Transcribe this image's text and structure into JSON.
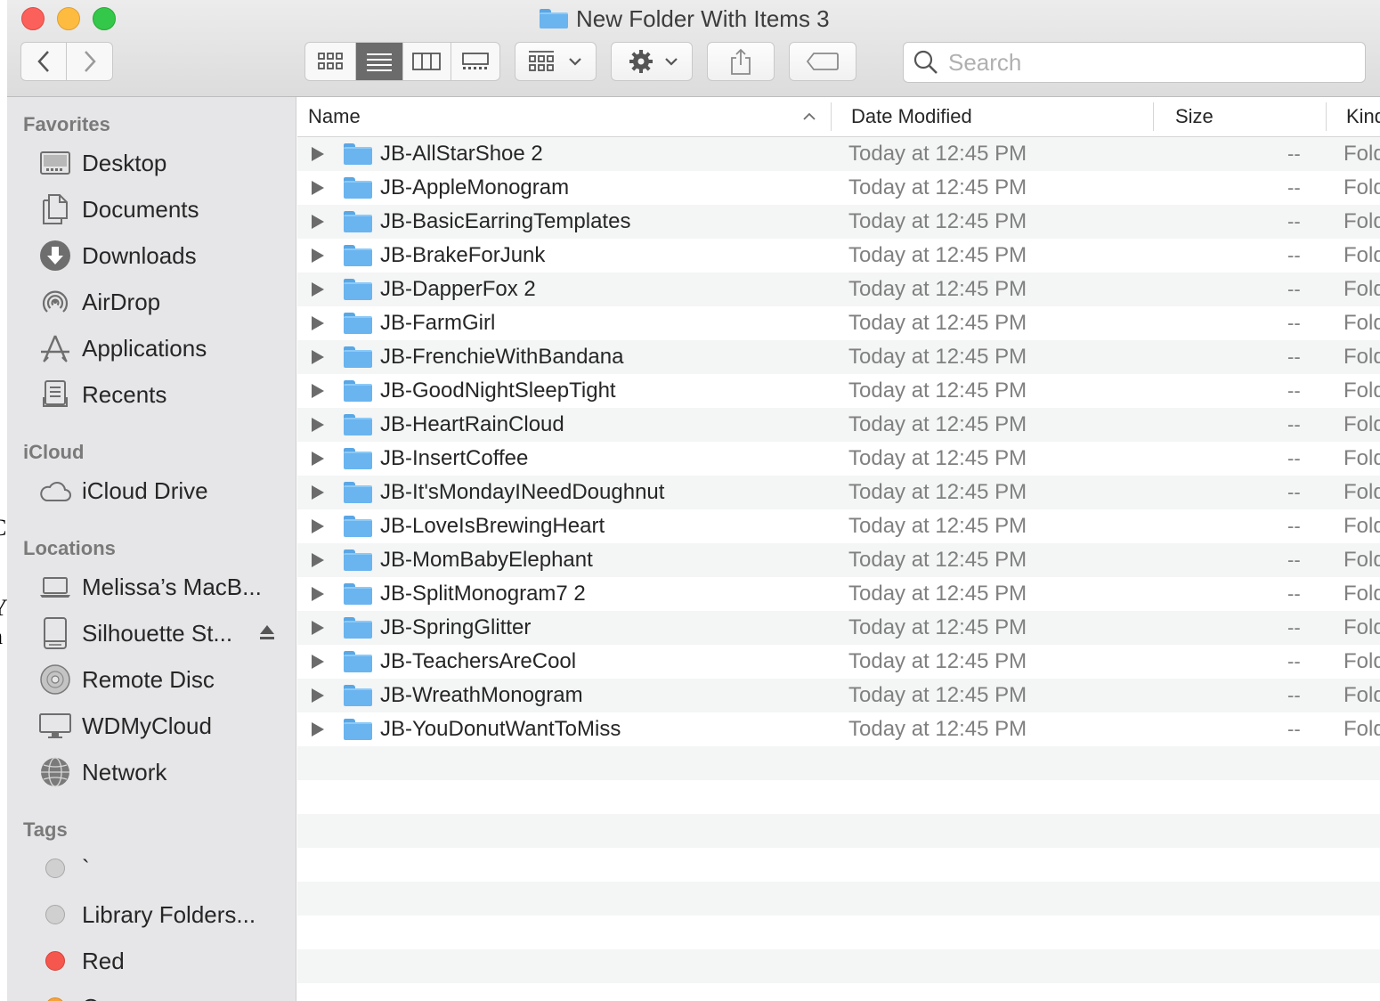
{
  "window": {
    "title": "New Folder With Items 3"
  },
  "background_fragments": [
    "C",
    "Y",
    "h"
  ],
  "toolbar": {
    "back_icon": "chevron-left-icon",
    "forward_icon": "chevron-right-icon",
    "view_modes": [
      "icon-view-icon",
      "list-view-icon",
      "column-view-icon",
      "gallery-view-icon"
    ],
    "active_view": "list",
    "search_placeholder": "Search"
  },
  "sidebar": {
    "sections": [
      {
        "heading": "Favorites",
        "items": [
          {
            "label": "Desktop",
            "icon": "desktop-icon"
          },
          {
            "label": "Documents",
            "icon": "documents-icon"
          },
          {
            "label": "Downloads",
            "icon": "downloads-icon"
          },
          {
            "label": "AirDrop",
            "icon": "airdrop-icon"
          },
          {
            "label": "Applications",
            "icon": "applications-icon"
          },
          {
            "label": "Recents",
            "icon": "recents-icon"
          }
        ]
      },
      {
        "heading": "iCloud",
        "items": [
          {
            "label": "iCloud Drive",
            "icon": "cloud-icon"
          }
        ]
      },
      {
        "heading": "Locations",
        "items": [
          {
            "label": "Melissa’s MacB...",
            "icon": "laptop-icon"
          },
          {
            "label": "Silhouette St...",
            "icon": "drive-icon",
            "eject": true
          },
          {
            "label": "Remote Disc",
            "icon": "disc-icon"
          },
          {
            "label": "WDMyCloud",
            "icon": "monitor-icon"
          },
          {
            "label": "Network",
            "icon": "globe-icon"
          }
        ]
      },
      {
        "heading": "Tags",
        "items": [
          {
            "label": "`",
            "icon": "tag-gray-icon",
            "color": "#d0d0d0"
          },
          {
            "label": "Library Folders...",
            "icon": "tag-gray-icon",
            "color": "#d0d0d0"
          },
          {
            "label": "Red",
            "icon": "tag-red-icon",
            "color": "#f5564e"
          },
          {
            "label": "O",
            "icon": "tag-orange-icon",
            "color": "#f7a33a"
          }
        ]
      }
    ]
  },
  "columns": {
    "name": "Name",
    "date_modified": "Date Modified",
    "size": "Size",
    "kind": "Kind"
  },
  "files": [
    {
      "name": "JB-AllStarShoe 2",
      "date": "Today at 12:45 PM",
      "size": "--",
      "kind": "Folder"
    },
    {
      "name": "JB-AppleMonogram",
      "date": "Today at 12:45 PM",
      "size": "--",
      "kind": "Folder"
    },
    {
      "name": "JB-BasicEarringTemplates",
      "date": "Today at 12:45 PM",
      "size": "--",
      "kind": "Folder"
    },
    {
      "name": "JB-BrakeForJunk",
      "date": "Today at 12:45 PM",
      "size": "--",
      "kind": "Folder"
    },
    {
      "name": "JB-DapperFox 2",
      "date": "Today at 12:45 PM",
      "size": "--",
      "kind": "Folder"
    },
    {
      "name": "JB-FarmGirl",
      "date": "Today at 12:45 PM",
      "size": "--",
      "kind": "Folder"
    },
    {
      "name": "JB-FrenchieWithBandana",
      "date": "Today at 12:45 PM",
      "size": "--",
      "kind": "Folder"
    },
    {
      "name": "JB-GoodNightSleepTight",
      "date": "Today at 12:45 PM",
      "size": "--",
      "kind": "Folder"
    },
    {
      "name": "JB-HeartRainCloud",
      "date": "Today at 12:45 PM",
      "size": "--",
      "kind": "Folder"
    },
    {
      "name": "JB-InsertCoffee",
      "date": "Today at 12:45 PM",
      "size": "--",
      "kind": "Folder"
    },
    {
      "name": "JB-It'sMondayINeedDoughnut",
      "date": "Today at 12:45 PM",
      "size": "--",
      "kind": "Folder"
    },
    {
      "name": "JB-LoveIsBrewingHeart",
      "date": "Today at 12:45 PM",
      "size": "--",
      "kind": "Folder"
    },
    {
      "name": "JB-MomBabyElephant",
      "date": "Today at 12:45 PM",
      "size": "--",
      "kind": "Folder"
    },
    {
      "name": "JB-SplitMonogram7 2",
      "date": "Today at 12:45 PM",
      "size": "--",
      "kind": "Folder"
    },
    {
      "name": "JB-SpringGlitter",
      "date": "Today at 12:45 PM",
      "size": "--",
      "kind": "Folder"
    },
    {
      "name": "JB-TeachersAreCool",
      "date": "Today at 12:45 PM",
      "size": "--",
      "kind": "Folder"
    },
    {
      "name": "JB-WreathMonogram",
      "date": "Today at 12:45 PM",
      "size": "--",
      "kind": "Folder"
    },
    {
      "name": "JB-YouDonutWantToMiss",
      "date": "Today at 12:45 PM",
      "size": "--",
      "kind": "Folder"
    }
  ],
  "colors": {
    "folder": "#6ab4f0",
    "selected_view": "#6b6b6b",
    "sidebar_bg": "#e6e6e8"
  }
}
